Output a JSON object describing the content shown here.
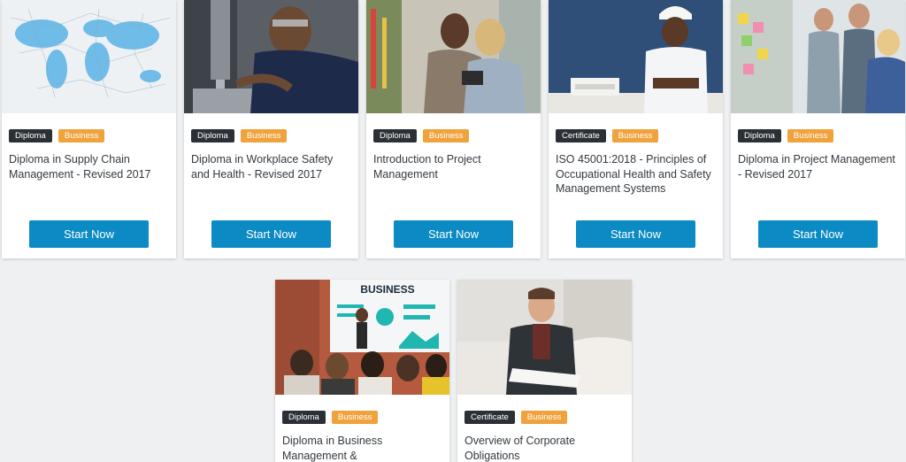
{
  "cards": [
    {
      "type": "Diploma",
      "category": "Business",
      "title": "Diploma in Supply Chain Management - Revised 2017",
      "button": "Start Now",
      "image": "world-network-map"
    },
    {
      "type": "Diploma",
      "category": "Business",
      "title": "Diploma in Workplace Safety and Health - Revised 2017",
      "button": "Start Now",
      "image": "worker-at-drill-press"
    },
    {
      "type": "Diploma",
      "category": "Business",
      "title": "Introduction to Project Management",
      "button": "Start Now",
      "image": "women-with-tablet"
    },
    {
      "type": "Certificate",
      "category": "Business",
      "title": "ISO 45001:2018 - Principles of Occupational Health and Safety Management Systems",
      "button": "Start Now",
      "image": "engineer-in-hard-hat"
    },
    {
      "type": "Diploma",
      "category": "Business",
      "title": "Diploma in Project Management - Revised 2017",
      "button": "Start Now",
      "image": "team-at-sticky-note-board"
    },
    {
      "type": "Diploma",
      "category": "Business",
      "title": "Diploma in Business Management &",
      "image": "business-presentation",
      "image_text": "BUSINESS"
    },
    {
      "type": "Certificate",
      "category": "Business",
      "title": "Overview of Corporate Obligations",
      "image": "man-reading-documents"
    }
  ],
  "colors": {
    "page_bg": "#eef0f2",
    "type_badge": "#2b3036",
    "category_badge": "#f0a23c",
    "button": "#0c8ac4"
  }
}
